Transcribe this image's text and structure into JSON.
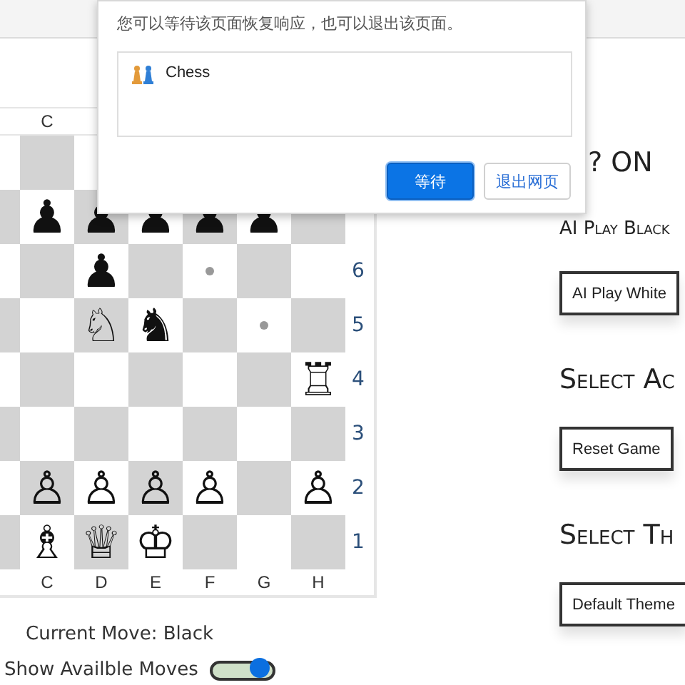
{
  "dialog": {
    "message": "您可以等待该页面恢复响应，也可以退出该页面。",
    "app": {
      "name": "Chess"
    },
    "buttons": [
      {
        "label": "等待",
        "primary": true
      },
      {
        "label": "退出网页",
        "primary": false
      }
    ]
  },
  "board": {
    "top_files": [
      "C"
    ],
    "bottom_files": [
      "C",
      "D",
      "E",
      "F",
      "G",
      "H"
    ],
    "rows": [
      {
        "cells": [
          {
            "kind": "empty"
          },
          {
            "kind": "empty"
          },
          {
            "kind": "empty"
          },
          {
            "kind": "empty"
          },
          {
            "kind": "empty"
          },
          {
            "kind": "empty"
          },
          {
            "kind": "empty"
          }
        ]
      },
      {
        "cells": [
          {
            "kind": "empty"
          },
          {
            "kind": "piece",
            "piece": "♟"
          },
          {
            "kind": "piece",
            "piece": "♟"
          },
          {
            "kind": "piece",
            "piece": "♟"
          },
          {
            "kind": "piece",
            "piece": "♟"
          },
          {
            "kind": "piece",
            "piece": "♟"
          },
          {
            "kind": "empty"
          }
        ]
      },
      {
        "rank": "6",
        "cells": [
          {
            "kind": "empty"
          },
          {
            "kind": "empty"
          },
          {
            "kind": "piece",
            "piece": "♟"
          },
          {
            "kind": "empty"
          },
          {
            "kind": "hint"
          },
          {
            "kind": "empty"
          },
          {
            "kind": "empty"
          }
        ]
      },
      {
        "rank": "5",
        "cells": [
          {
            "kind": "empty"
          },
          {
            "kind": "empty"
          },
          {
            "kind": "piece",
            "piece": "♘"
          },
          {
            "kind": "piece",
            "piece": "♞"
          },
          {
            "kind": "empty"
          },
          {
            "kind": "hint"
          },
          {
            "kind": "empty"
          }
        ]
      },
      {
        "rank": "4",
        "cells": [
          {
            "kind": "empty"
          },
          {
            "kind": "empty"
          },
          {
            "kind": "empty"
          },
          {
            "kind": "empty"
          },
          {
            "kind": "empty"
          },
          {
            "kind": "empty"
          },
          {
            "kind": "piece",
            "piece": "♖"
          }
        ]
      },
      {
        "rank": "3",
        "cells": [
          {
            "kind": "empty"
          },
          {
            "kind": "empty"
          },
          {
            "kind": "empty"
          },
          {
            "kind": "empty"
          },
          {
            "kind": "empty"
          },
          {
            "kind": "empty"
          },
          {
            "kind": "empty"
          }
        ]
      },
      {
        "rank": "2",
        "cells": [
          {
            "kind": "empty"
          },
          {
            "kind": "piece",
            "piece": "♙"
          },
          {
            "kind": "piece",
            "piece": "♙"
          },
          {
            "kind": "piece",
            "piece": "♙"
          },
          {
            "kind": "piece",
            "piece": "♙"
          },
          {
            "kind": "empty"
          },
          {
            "kind": "piece",
            "piece": "♙"
          }
        ]
      },
      {
        "rank": "1",
        "cells": [
          {
            "kind": "empty"
          },
          {
            "kind": "piece",
            "piece": "♗"
          },
          {
            "kind": "piece",
            "piece": "♕"
          },
          {
            "kind": "piece",
            "piece": "♔"
          },
          {
            "kind": "empty"
          },
          {
            "kind": "empty"
          },
          {
            "kind": "empty"
          }
        ]
      }
    ]
  },
  "current_move": "Current Move: Black",
  "toggle": {
    "label": "Show Availble Moves",
    "on": true
  },
  "panel": {
    "sections": [
      {
        "heading": "? ON",
        "note": "AI Play Black",
        "buttons": [
          "AI Play White"
        ]
      },
      {
        "heading": "Select Ac",
        "buttons": [
          "Reset Game"
        ]
      },
      {
        "heading": "Select Th",
        "buttons": [
          "Default Theme"
        ]
      }
    ]
  }
}
